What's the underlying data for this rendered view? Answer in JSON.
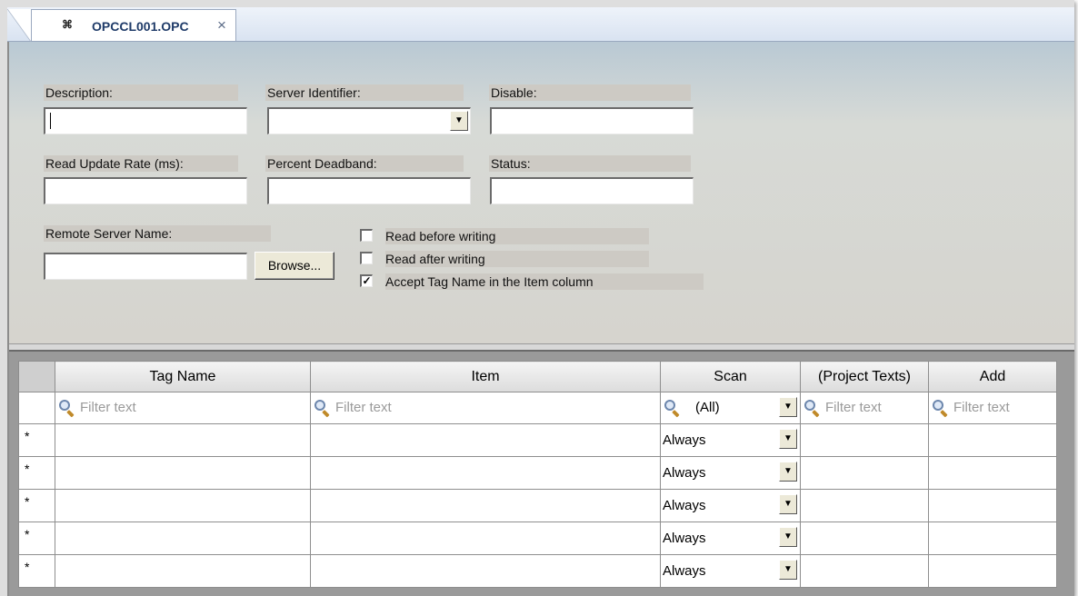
{
  "tab": {
    "icon": "opc-server-icon",
    "icon_glyph": "⌘",
    "title": "OPCCL001.OPC",
    "close": "×"
  },
  "form": {
    "description": {
      "label": "Description:",
      "value": ""
    },
    "server_identifier": {
      "label": "Server Identifier:",
      "value": ""
    },
    "disable": {
      "label": "Disable:",
      "value": ""
    },
    "read_update_rate": {
      "label": "Read Update Rate (ms):",
      "value": ""
    },
    "percent_deadband": {
      "label": "Percent Deadband:",
      "value": ""
    },
    "status": {
      "label": "Status:",
      "value": ""
    },
    "remote_server_name": {
      "label": "Remote Server Name:",
      "value": ""
    },
    "browse_label": "Browse...",
    "checkboxes": [
      {
        "label": "Read before writing",
        "checked": false
      },
      {
        "label": "Read after writing",
        "checked": false
      },
      {
        "label": "Accept Tag Name in the Item column",
        "checked": true
      }
    ]
  },
  "grid": {
    "columns": [
      "Tag Name",
      "Item",
      "Scan",
      "(Project Texts)",
      "Add"
    ],
    "filter_placeholder": "Filter text",
    "scan_filter_value": "(All)",
    "row_marker": "*",
    "rows": [
      {
        "tag_name": "",
        "item": "",
        "scan": "Always",
        "project_texts": "",
        "add": ""
      },
      {
        "tag_name": "",
        "item": "",
        "scan": "Always",
        "project_texts": "",
        "add": ""
      },
      {
        "tag_name": "",
        "item": "",
        "scan": "Always",
        "project_texts": "",
        "add": ""
      },
      {
        "tag_name": "",
        "item": "",
        "scan": "Always",
        "project_texts": "",
        "add": ""
      },
      {
        "tag_name": "",
        "item": "",
        "scan": "Always",
        "project_texts": "",
        "add": ""
      }
    ]
  },
  "colors": {
    "form_top": "#b9c9d4",
    "form_bottom": "#d6d4ce",
    "grid_background": "#9a9a9a",
    "tab_title": "#1f3b69"
  }
}
